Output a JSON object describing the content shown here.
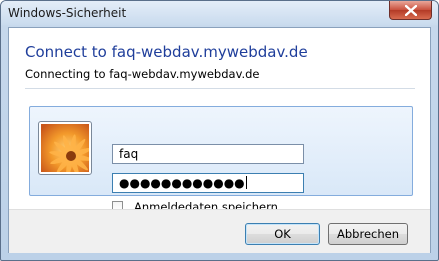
{
  "window": {
    "title": "Windows-Sicherheit",
    "close_icon": "close-icon"
  },
  "dialog": {
    "heading": "Connect to faq-webdav.mywebdav.de",
    "subheading": "Connecting to faq-webdav.mywebdav.de"
  },
  "credentials": {
    "avatar_icon": "user-avatar-flower-icon",
    "username_value": "faq",
    "password_value": "●●●●●●●●●●●●",
    "remember_label": "Anmeldedaten speichern",
    "remember_checked": false
  },
  "buttons": {
    "ok_label": "OK",
    "cancel_label": "Abbrechen"
  },
  "colors": {
    "heading": "#1f3e9b",
    "close_button": "#c9503d"
  }
}
